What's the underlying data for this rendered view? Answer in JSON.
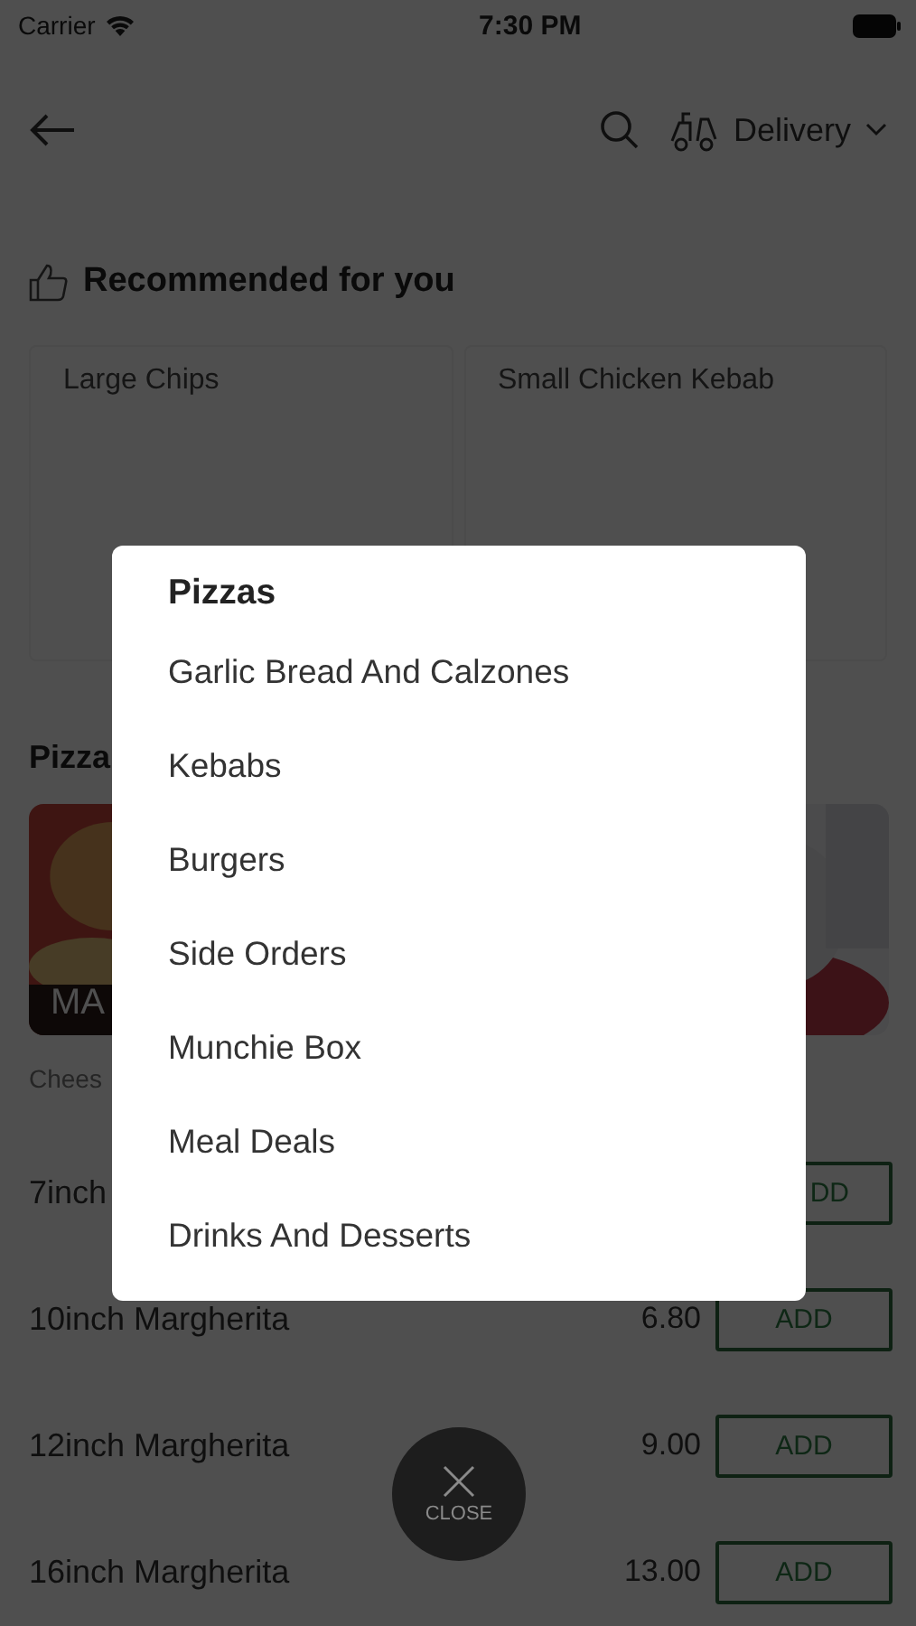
{
  "status_bar": {
    "carrier": "Carrier",
    "time": "7:30 PM"
  },
  "header": {
    "mode": "Delivery"
  },
  "recommended": {
    "title": "Recommended for you",
    "items": [
      "Large Chips",
      "Small Chicken Kebab"
    ]
  },
  "section": {
    "title": "Pizza",
    "cards": [
      {
        "kind": "picture",
        "label": "MA"
      },
      {
        "kind": "picture"
      }
    ],
    "caption": "Chees"
  },
  "items": [
    {
      "name": "7inch",
      "add": "DD"
    },
    {
      "name": "10inch Margherita",
      "price": "6.80",
      "add": "ADD"
    },
    {
      "name": "12inch Margherita",
      "price": "9.00",
      "add": "ADD"
    },
    {
      "name": "16inch Margherita",
      "price": "13.00",
      "add": "ADD"
    }
  ],
  "category_menu": {
    "items": [
      {
        "label": "Pizzas",
        "selected": true
      },
      {
        "label": "Garlic Bread And Calzones",
        "selected": false
      },
      {
        "label": "Kebabs",
        "selected": false
      },
      {
        "label": "Burgers",
        "selected": false
      },
      {
        "label": "Side Orders",
        "selected": false
      },
      {
        "label": "Munchie Box",
        "selected": false
      },
      {
        "label": "Meal Deals",
        "selected": false
      },
      {
        "label": "Drinks And Desserts",
        "selected": false
      }
    ]
  },
  "close": {
    "label": "CLOSE"
  }
}
